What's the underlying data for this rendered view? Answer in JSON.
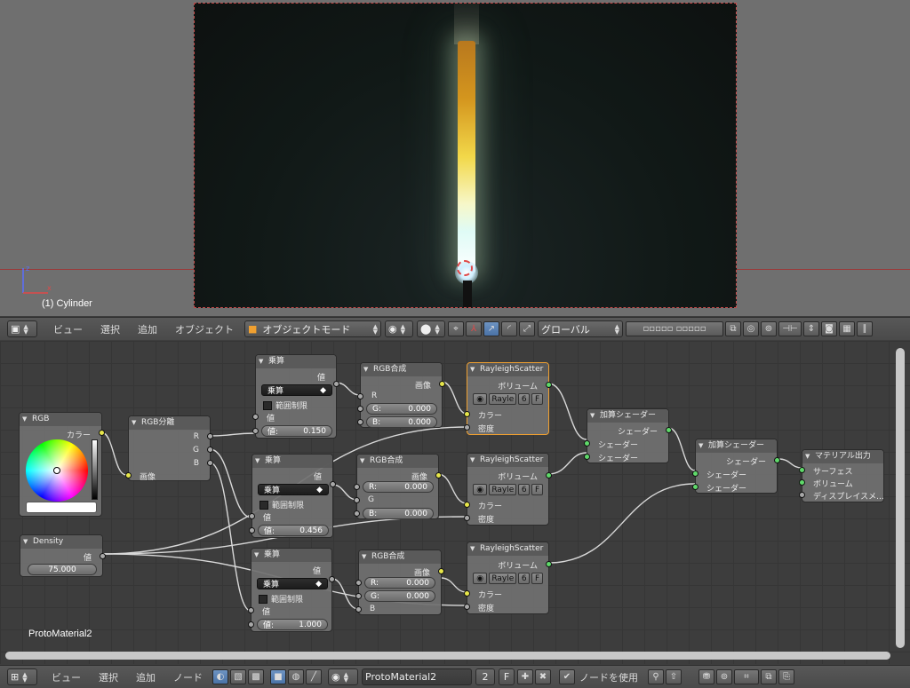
{
  "viewport": {
    "object_label": "(1) Cylinder",
    "header": {
      "menu": [
        "ビュー",
        "選択",
        "追加",
        "オブジェクト"
      ],
      "mode": "オブジェクトモード",
      "orientation": "グローバル"
    }
  },
  "node_editor": {
    "material_name": "ProtoMaterial2",
    "nodes": {
      "rgb": {
        "title": "RGB",
        "out_color": "カラー"
      },
      "separate": {
        "title": "RGB分離",
        "in_image": "画像",
        "r": "R",
        "g": "G",
        "b": "B"
      },
      "math1": {
        "title": "乗算",
        "out": "値",
        "op": "乗算",
        "clamp": "範囲制限",
        "in": "値",
        "val_label": "値:",
        "value": "0.150"
      },
      "math2": {
        "title": "乗算",
        "out": "値",
        "op": "乗算",
        "clamp": "範囲制限",
        "in": "値",
        "val_label": "値:",
        "value": "0.456"
      },
      "math3": {
        "title": "乗算",
        "out": "値",
        "op": "乗算",
        "clamp": "範囲制限",
        "in": "値",
        "val_label": "値:",
        "value": "1.000"
      },
      "comb1": {
        "title": "RGB合成",
        "out": "画像",
        "r": "R",
        "g_label": "G:",
        "g": "0.000",
        "b_label": "B:",
        "b": "0.000"
      },
      "comb2": {
        "title": "RGB合成",
        "out": "画像",
        "r_label": "R:",
        "r": "0.000",
        "g": "G",
        "b_label": "B:",
        "b": "0.000"
      },
      "comb3": {
        "title": "RGB合成",
        "out": "画像",
        "r_label": "R:",
        "r": "0.000",
        "g_label": "G:",
        "g": "0.000",
        "b": "B"
      },
      "rs1": {
        "title": "RayleighScatter",
        "out": "ボリューム",
        "name": "Rayle",
        "users": "6",
        "fake": "F",
        "color": "カラー",
        "density": "密度"
      },
      "rs2": {
        "title": "RayleighScatter",
        "out": "ボリューム",
        "name": "Rayle",
        "users": "6",
        "fake": "F",
        "color": "カラー",
        "density": "密度"
      },
      "rs3": {
        "title": "RayleighScatter",
        "out": "ボリューム",
        "name": "Rayle",
        "users": "6",
        "fake": "F",
        "color": "カラー",
        "density": "密度"
      },
      "density": {
        "title": "Density",
        "out": "値",
        "value": "75.000"
      },
      "add1": {
        "title": "加算シェーダー",
        "out": "シェーダー",
        "in1": "シェーダー",
        "in2": "シェーダー"
      },
      "add2": {
        "title": "加算シェーダー",
        "out": "シェーダー",
        "in1": "シェーダー",
        "in2": "シェーダー"
      },
      "output": {
        "title": "マテリアル出力",
        "surface": "サーフェス",
        "volume": "ボリューム",
        "displacement": "ディスプレイスメ..."
      }
    }
  },
  "node_header": {
    "menu": [
      "ビュー",
      "選択",
      "追加",
      "ノード"
    ],
    "material": "ProtoMaterial2",
    "users": "2",
    "fake": "F",
    "use_nodes": "ノードを使用"
  },
  "colors": {
    "accent": "#5680c2",
    "selected": "#f0a030",
    "socket_color": "#e7e64a",
    "socket_shader": "#5fd96a",
    "socket_value": "#a8a8a8"
  }
}
